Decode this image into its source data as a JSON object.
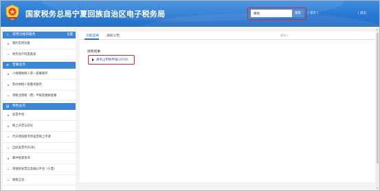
{
  "header": {
    "site_title": "国家税务总局宁夏回族自治区电子税务局",
    "search": {
      "value": "耕地",
      "button_label": "搜索"
    },
    "links_text": "| 首页 |",
    "exit_text": "| 退出",
    "colors": {
      "header_blue": "#2a78d2",
      "highlight_red": "#e0262b"
    }
  },
  "sidebar": {
    "sections": [
      {
        "title": "常用功能和服务",
        "extra": "设置",
        "icon": "star-icon",
        "items": [
          {
            "label": "我的常用功能"
          },
          {
            "label": "财务会计制度备案"
          }
        ]
      },
      {
        "title": "套餐业务",
        "icon": "stack-icon",
        "items": [
          {
            "label": "小规模纳税人第一套餐服务"
          },
          {
            "label": "新办纳税人套餐式服务"
          },
          {
            "label": "清税注销税（费）申报及缴纳套餐"
          }
        ]
      },
      {
        "title": "特色业务",
        "icon": "list-icon",
        "items": [
          {
            "label": "发票申领"
          },
          {
            "label": "网上开票与验证"
          },
          {
            "label": "代开增值税专用发票网上申请"
          },
          {
            "label": "自助发票代开(机)"
          },
          {
            "label": "集中税源查询"
          },
          {
            "label": "增值税发票信息确认平台（宁夏）"
          },
          {
            "label": "税税互动"
          }
        ]
      }
    ]
  },
  "main": {
    "tabs": [
      {
        "label": "功能菜单"
      },
      {
        "label": "通知公告"
      }
    ],
    "tab_right_text": "更多>",
    "result_heading": "搜索结果",
    "results": [
      {
        "label": "耕地占用税申报(2019)"
      }
    ]
  }
}
